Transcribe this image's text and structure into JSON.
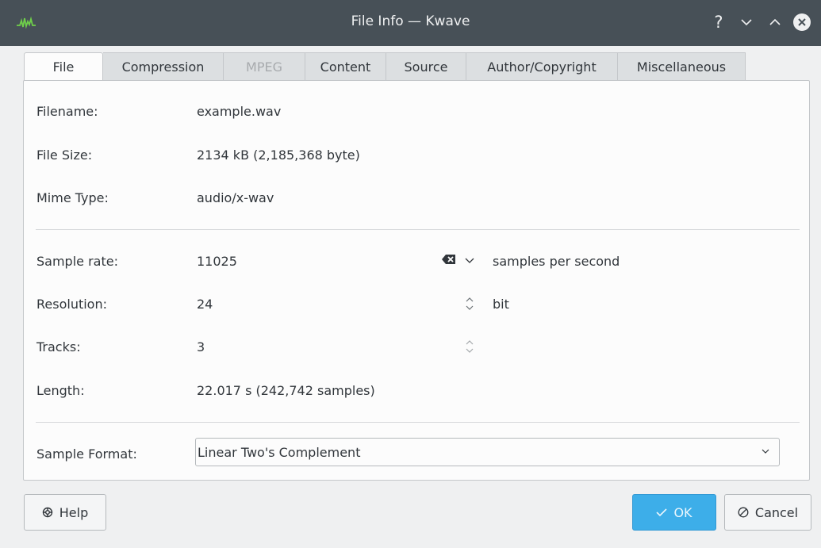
{
  "window": {
    "title": "File Info — Kwave",
    "help_glyph": "?",
    "icons": [
      "kwave-app-icon",
      "help-icon",
      "minimize-icon",
      "maximize-icon",
      "close-icon"
    ]
  },
  "tabs": [
    {
      "label": "File",
      "active": true,
      "disabled": false
    },
    {
      "label": "Compression",
      "active": false,
      "disabled": false
    },
    {
      "label": "MPEG",
      "active": false,
      "disabled": true
    },
    {
      "label": "Content",
      "active": false,
      "disabled": false
    },
    {
      "label": "Source",
      "active": false,
      "disabled": false
    },
    {
      "label": "Author/Copyright",
      "active": false,
      "disabled": false
    },
    {
      "label": "Miscellaneous",
      "active": false,
      "disabled": false
    }
  ],
  "file": {
    "filename_label": "Filename:",
    "filename_value": "example.wav",
    "filesize_label": "File Size:",
    "filesize_value": "2134 kB (2,185,368 byte)",
    "mime_label": "Mime Type:",
    "mime_value": "audio/x-wav"
  },
  "audio": {
    "samplerate_label": "Sample rate:",
    "samplerate_value": "11025",
    "samplerate_unit": "samples per second",
    "resolution_label": "Resolution:",
    "resolution_value": "24",
    "resolution_unit": "bit",
    "tracks_label": "Tracks:",
    "tracks_value": "3",
    "length_label": "Length:",
    "length_value": "22.017 s (242,742 samples)"
  },
  "format": {
    "label": "Sample Format:",
    "selected": "Linear Two's Complement"
  },
  "buttons": {
    "help": "Help",
    "ok": "OK",
    "cancel": "Cancel"
  },
  "colors": {
    "titlebar": "#475057",
    "window_bg": "#eff0f1",
    "panel_bg": "#fcfcfc",
    "accent": "#3daee9"
  }
}
